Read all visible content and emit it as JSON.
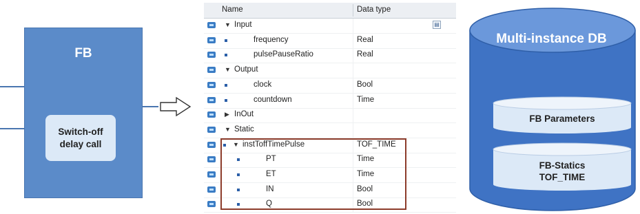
{
  "fb_block": {
    "title": "FB",
    "call_label": "Switch-off\ndelay call"
  },
  "interface_table": {
    "headers": {
      "name": "Name",
      "data_type": "Data type"
    },
    "rows": [
      {
        "name": "Input",
        "data_type": "",
        "kind": "section",
        "expander": "expanded"
      },
      {
        "name": "frequency",
        "data_type": "Real",
        "kind": "item"
      },
      {
        "name": "pulsePauseRatio",
        "data_type": "Real",
        "kind": "item"
      },
      {
        "name": "Output",
        "data_type": "",
        "kind": "section",
        "expander": "expanded"
      },
      {
        "name": "clock",
        "data_type": "Bool",
        "kind": "item"
      },
      {
        "name": "countdown",
        "data_type": "Time",
        "kind": "item"
      },
      {
        "name": "InOut",
        "data_type": "",
        "kind": "section",
        "expander": "collapsed"
      },
      {
        "name": "Static",
        "data_type": "",
        "kind": "section",
        "expander": "expanded"
      },
      {
        "name": "instToffTimePulse",
        "data_type": "TOF_TIME",
        "kind": "instance",
        "expander": "expanded"
      },
      {
        "name": "PT",
        "data_type": "Time",
        "kind": "member"
      },
      {
        "name": "ET",
        "data_type": "Time",
        "kind": "member"
      },
      {
        "name": "IN",
        "data_type": "Bool",
        "kind": "member"
      },
      {
        "name": "Q",
        "data_type": "Bool",
        "kind": "member"
      }
    ]
  },
  "database": {
    "title": "Multi-instance DB",
    "parameters_label": "FB Parameters",
    "statics_label": "FB-Statics\nTOF_TIME"
  },
  "colors": {
    "fb_blue": "#5b8bc9",
    "call_box": "#dce9f7",
    "db_blue": "#3f73c4",
    "highlight": "#8c3b2a",
    "row_icon": "#3a7cc4"
  }
}
